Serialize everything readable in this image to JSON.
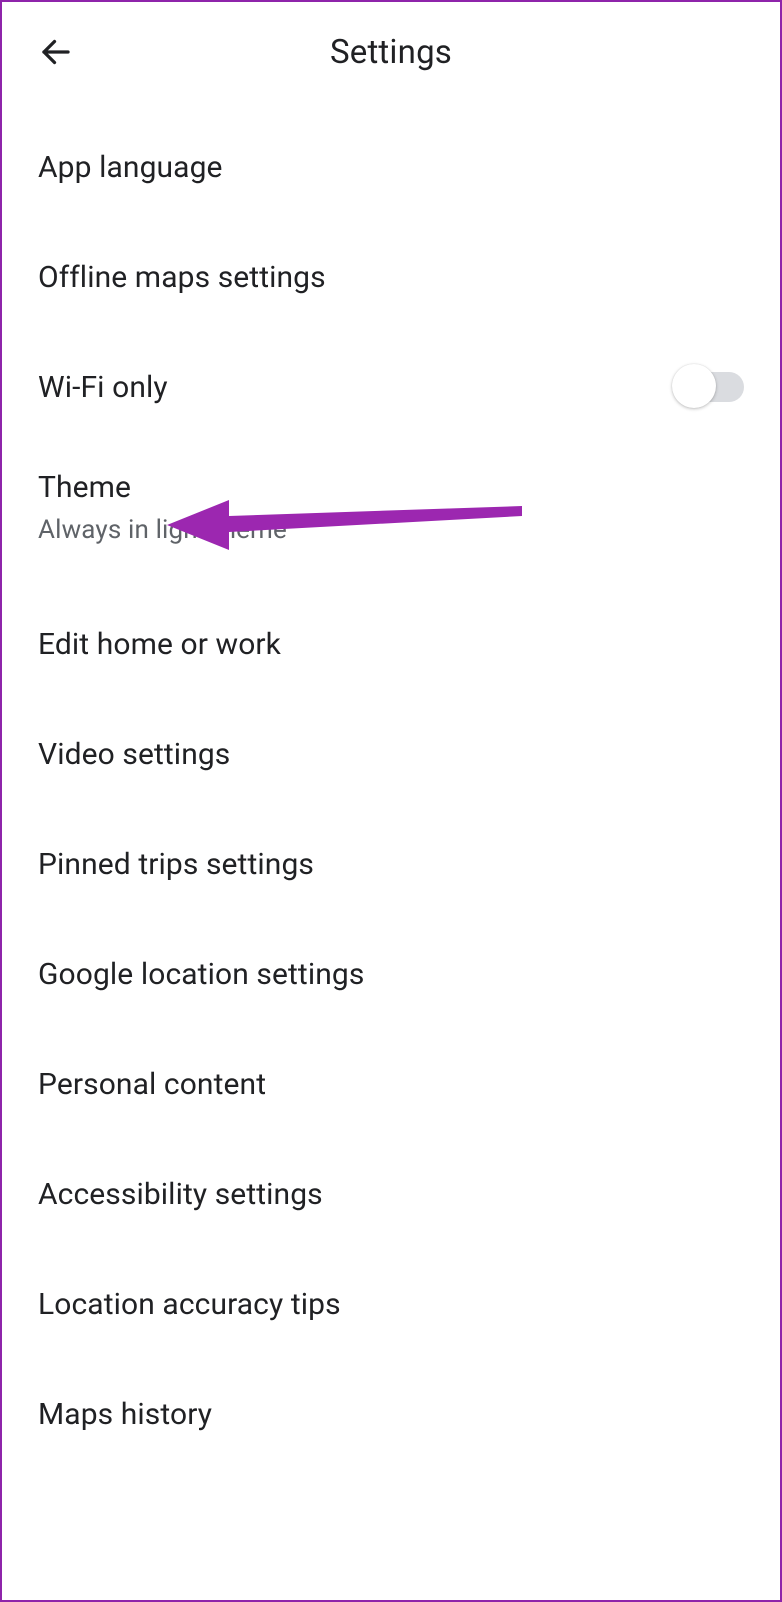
{
  "header": {
    "title": "Settings"
  },
  "settings": {
    "app_language": {
      "label": "App language"
    },
    "offline_maps": {
      "label": "Offline maps settings"
    },
    "wifi_only": {
      "label": "Wi-Fi only",
      "toggle_on": false
    },
    "theme": {
      "label": "Theme",
      "sublabel": "Always in light theme"
    },
    "edit_home_work": {
      "label": "Edit home or work"
    },
    "video_settings": {
      "label": "Video settings"
    },
    "pinned_trips": {
      "label": "Pinned trips settings"
    },
    "google_location": {
      "label": "Google location settings"
    },
    "personal_content": {
      "label": "Personal content"
    },
    "accessibility": {
      "label": "Accessibility settings"
    },
    "location_accuracy": {
      "label": "Location accuracy tips"
    },
    "maps_history": {
      "label": "Maps history"
    }
  },
  "annotation": {
    "arrow_color": "#9c27b0"
  }
}
